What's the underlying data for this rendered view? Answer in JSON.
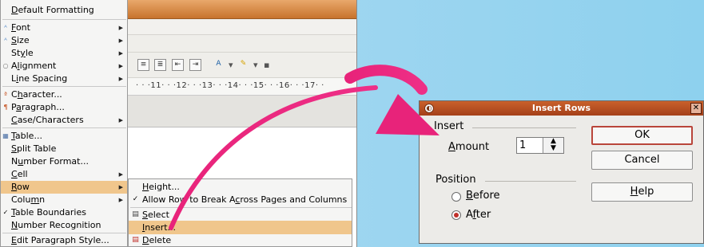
{
  "format_menu": {
    "items": [
      {
        "label": "Default Formatting",
        "u": "D"
      },
      {
        "label": "Font",
        "u": "F"
      },
      {
        "label": "Size",
        "u": "S"
      },
      {
        "label": "Style",
        "u": "y"
      },
      {
        "label": "Alignment",
        "u": "l"
      },
      {
        "label": "Line Spacing",
        "u": "i"
      },
      {
        "label": "Character...",
        "u": "h"
      },
      {
        "label": "Paragraph...",
        "u": "a"
      },
      {
        "label": "Case/Characters",
        "u": "C"
      },
      {
        "label": "Table...",
        "u": "T"
      },
      {
        "label": "Split Table",
        "u": "S"
      },
      {
        "label": "Number Format...",
        "u": "u"
      },
      {
        "label": "Cell",
        "u": "C"
      },
      {
        "label": "Row",
        "u": "R"
      },
      {
        "label": "Column",
        "u": "m"
      },
      {
        "label": "Table Boundaries",
        "u": "T"
      },
      {
        "label": "Number Recognition",
        "u": "N"
      },
      {
        "label": "Edit Paragraph Style...",
        "u": "E"
      }
    ]
  },
  "row_submenu": {
    "items": [
      {
        "label": "Height...",
        "u": "H"
      },
      {
        "label": "Allow Row to Break Across Pages and Columns",
        "u": "c"
      },
      {
        "label": "Select",
        "u": "S"
      },
      {
        "label": "Insert...",
        "u": "I"
      },
      {
        "label": "Delete",
        "u": "D"
      }
    ]
  },
  "ruler": {
    "text": "· · ·11· · ·12· · ·13· · ·14· · ·15· · ·16· · ·17· ·"
  },
  "dialog": {
    "title": "Insert Rows",
    "insert_group": "Insert",
    "amount_label": "Amount",
    "amount_value": "1",
    "position_group": "Position",
    "before_label": "Before",
    "after_label": "After",
    "ok": "OK",
    "cancel": "Cancel",
    "help": "Help",
    "selected_position": "After"
  },
  "icons": {
    "arrow": "curved-pink-arrow",
    "accent": "#e8237a"
  }
}
